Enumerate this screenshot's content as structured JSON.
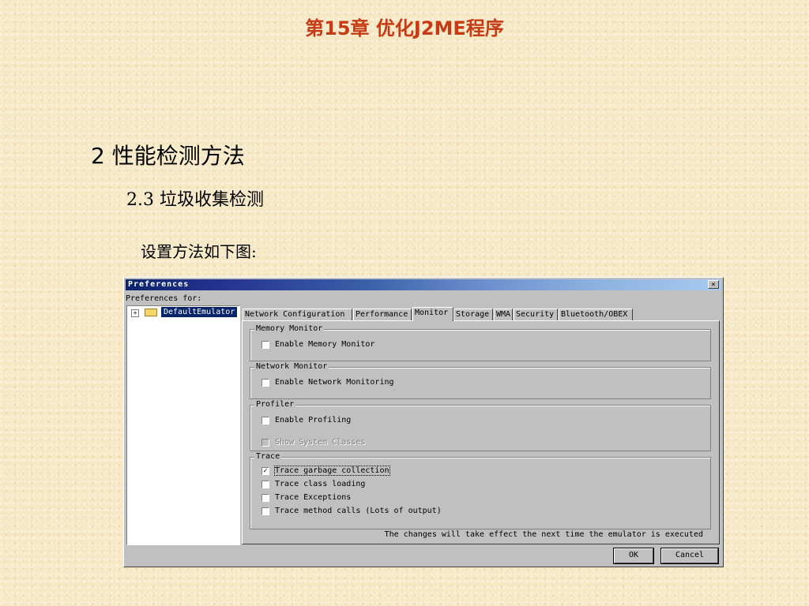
{
  "slide": {
    "title": "第15章 优化J2ME程序",
    "heading1": "2 性能检测方法",
    "heading2": "2.3 垃圾收集检测",
    "heading3": "设置方法如下图:"
  },
  "dialog": {
    "title": "Preferences",
    "close_icon": "×",
    "prefs_for_label": "Preferences for:",
    "tree": {
      "expander": "+",
      "node": "DefaultEmulator"
    },
    "tabs": [
      {
        "label": "Network Configuration",
        "active": false
      },
      {
        "label": "Performance",
        "active": false
      },
      {
        "label": "Monitor",
        "active": true
      },
      {
        "label": "Storage",
        "active": false
      },
      {
        "label": "WMA",
        "active": false
      },
      {
        "label": "Security",
        "active": false
      },
      {
        "label": "Bluetooth/OBEX",
        "active": false
      }
    ],
    "groups": {
      "memory": {
        "legend": "Memory Monitor",
        "items": [
          {
            "label": "Enable Memory Monitor",
            "checked": false
          }
        ]
      },
      "network": {
        "legend": "Network Monitor",
        "items": [
          {
            "label": "Enable Network Monitoring",
            "checked": false
          }
        ]
      },
      "profiler": {
        "legend": "Profiler",
        "items": [
          {
            "label": "Enable Profiling",
            "checked": false
          },
          {
            "label": "Show System Classes",
            "checked": false,
            "disabled": true
          }
        ]
      },
      "trace": {
        "legend": "Trace",
        "items": [
          {
            "label": "Trace garbage collection",
            "checked": true
          },
          {
            "label": "Trace class loading",
            "checked": false
          },
          {
            "label": "Trace Exceptions",
            "checked": false
          },
          {
            "label": "Trace method calls (Lots of output)",
            "checked": false
          }
        ]
      }
    },
    "check_mark": "✓",
    "note": "The changes will take effect the next time the emulator is executed",
    "ok_label": "OK",
    "cancel_label": "Cancel"
  }
}
